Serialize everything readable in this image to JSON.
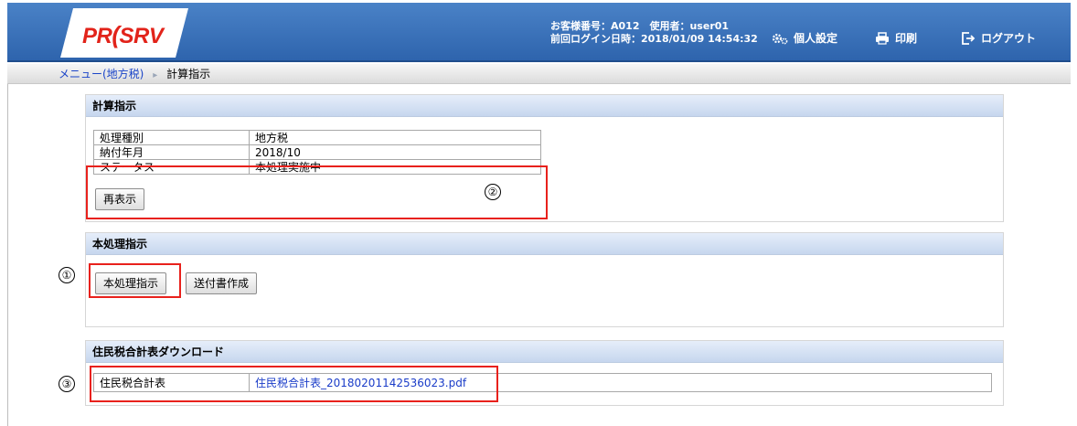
{
  "header": {
    "logo": "PRO SRV",
    "customer_line": "お客様番号：A012　使用者：user01",
    "last_login_line": "前回ログイン日時：2018/01/09 14:54:32",
    "personal_settings": "個人設定",
    "print": "印刷",
    "logout": "ログアウト"
  },
  "breadcrumb": {
    "parent": "メニュー(地方税)",
    "current": "計算指示"
  },
  "calc_panel": {
    "title": "計算指示",
    "rows": [
      {
        "label": "処理種別",
        "value": "地方税"
      },
      {
        "label": "納付年月",
        "value": "2018/10"
      },
      {
        "label": "ステータス",
        "value": "本処理実施中"
      }
    ],
    "refresh_button": "再表示"
  },
  "main_panel": {
    "title": "本処理指示",
    "main_button": "本処理指示",
    "cover_button": "送付書作成"
  },
  "download_panel": {
    "title": "住民税合計表ダウンロード",
    "row_label": "住民税合計表",
    "file_name": "住民税合計表_20180201142536023.pdf"
  },
  "annotations": {
    "one": "①",
    "two": "②",
    "three": "③"
  },
  "colors": {
    "header_blue": "#2e64ad",
    "logo_red": "#e2231a",
    "highlight_red": "#e8211c",
    "link_blue": "#1a44c8"
  }
}
